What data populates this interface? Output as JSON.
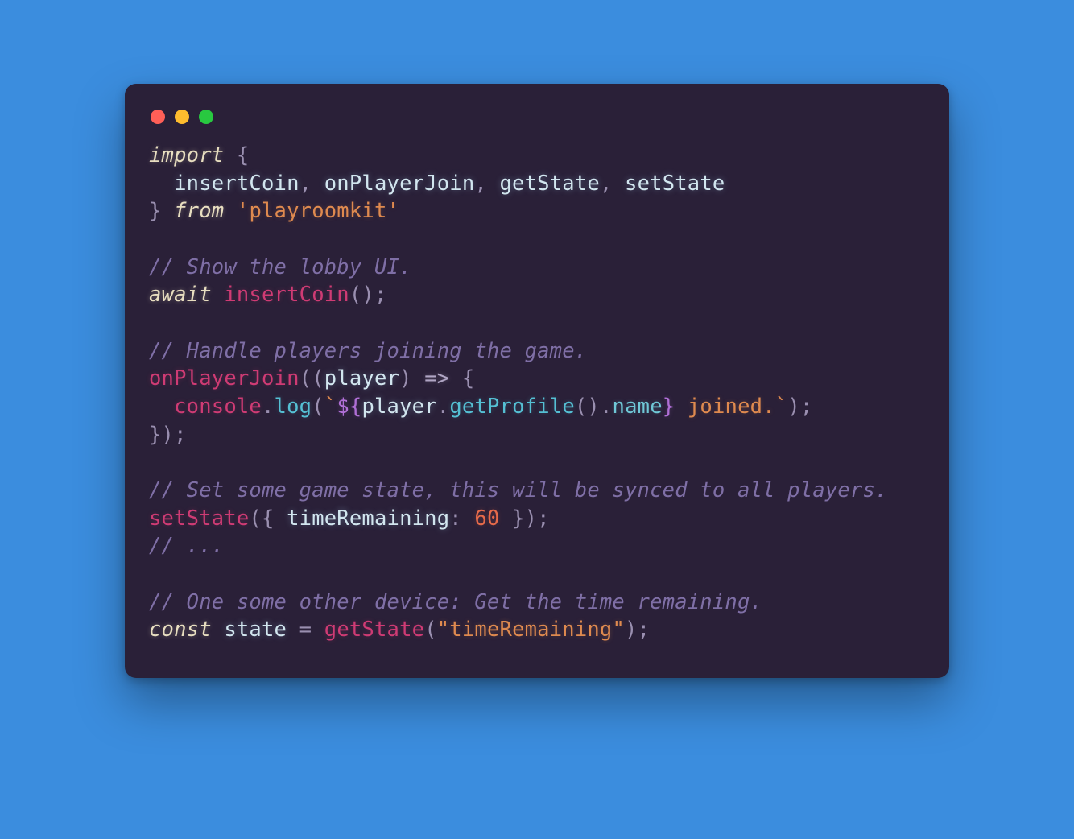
{
  "colors": {
    "page_bg": "#3b8dde",
    "window_bg": "#2a2038",
    "traffic_red": "#ff5f57",
    "traffic_yellow": "#febc2e",
    "traffic_green": "#28c840",
    "keyword": "#e8dec0",
    "identifier": "#d2e6ef",
    "function_decl": "#cf3b74",
    "call": "#55c0d4",
    "property": "#6fc7d6",
    "string": "#df8a4f",
    "number": "#e66a4a",
    "comment": "#7f6fa6",
    "punct": "#9a8fb0",
    "template_marker": "#b06fd6"
  },
  "code": {
    "l01_import": "import",
    "l01_brace": " {",
    "l02_indent": "  ",
    "l02_a": "insertCoin",
    "l02_sep1": ", ",
    "l02_b": "onPlayerJoin",
    "l02_sep2": ", ",
    "l02_c": "getState",
    "l02_sep3": ", ",
    "l02_d": "setState",
    "l03_close": "} ",
    "l03_from": "from",
    "l03_space": " ",
    "l03_str": "'playroomkit'",
    "l05_cmt": "// Show the lobby UI.",
    "l06_await": "await",
    "l06_space": " ",
    "l06_fn": "insertCoin",
    "l06_call": "();",
    "l08_cmt": "// Handle players joining the game.",
    "l09_fn": "onPlayerJoin",
    "l09_open": "((",
    "l09_param": "player",
    "l09_close_paren": ") ",
    "l09_arrow": "=>",
    "l09_brace": " {",
    "l10_indent": "  ",
    "l10_console": "console",
    "l10_dot1": ".",
    "l10_log": "log",
    "l10_open": "(",
    "l10_bt1": "`",
    "l10_tplopen": "${",
    "l10_player": "player",
    "l10_dot2": ".",
    "l10_getprof": "getProfile",
    "l10_parens": "().",
    "l10_name": "name",
    "l10_tplclose": "}",
    "l10_tail": " joined.",
    "l10_bt2": "`",
    "l10_end": ");",
    "l11_close": "});",
    "l13_cmt": "// Set some game state, this will be synced to all players.",
    "l14_fn": "setState",
    "l14_open": "({ ",
    "l14_key": "timeRemaining",
    "l14_colon": ": ",
    "l14_num": "60",
    "l14_close": " });",
    "l15_cmt": "// ...",
    "l17_cmt": "// One some other device: Get the time remaining.",
    "l18_const": "const",
    "l18_space1": " ",
    "l18_var": "state",
    "l18_eq": " = ",
    "l18_fn": "getState",
    "l18_open": "(",
    "l18_str": "\"timeRemaining\"",
    "l18_close": ");"
  }
}
